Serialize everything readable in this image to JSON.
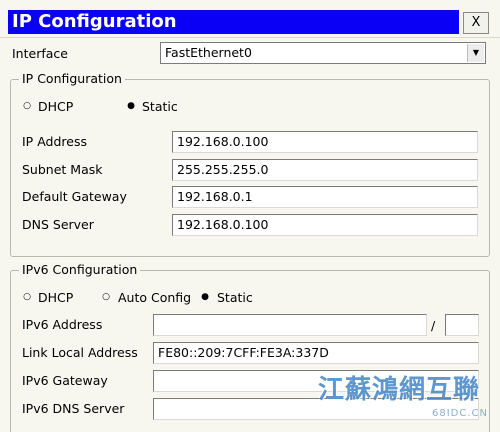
{
  "window": {
    "title": "IP Configuration",
    "close_label": "X"
  },
  "interface": {
    "label": "Interface",
    "selected": "FastEthernet0"
  },
  "ipv4": {
    "legend": "IP Configuration",
    "dhcp_label": "DHCP",
    "static_label": "Static",
    "mode": "Static",
    "ip_address_label": "IP Address",
    "ip_address": "192.168.0.100",
    "subnet_mask_label": "Subnet Mask",
    "subnet_mask": "255.255.255.0",
    "default_gateway_label": "Default Gateway",
    "default_gateway": "192.168.0.1",
    "dns_server_label": "DNS Server",
    "dns_server": "192.168.0.100"
  },
  "ipv6": {
    "legend": "IPv6 Configuration",
    "dhcp_label": "DHCP",
    "auto_config_label": "Auto Config",
    "static_label": "Static",
    "mode": "Static",
    "address_label": "IPv6 Address",
    "address": "",
    "prefix_separator": "/",
    "prefix_length": "",
    "link_local_label": "Link Local Address",
    "link_local": "FE80::209:7CFF:FE3A:337D",
    "gateway_label": "IPv6 Gateway",
    "gateway": "",
    "dns_server_label": "IPv6 DNS Server",
    "dns_server": ""
  },
  "watermark": {
    "text": "江蘇鴻網互聯",
    "subtext": "68IDC.CN"
  },
  "icons": {
    "radio_selected": "radio-selected",
    "radio_unselected": "radio-unselected",
    "dropdown": "chevron-down-icon"
  }
}
